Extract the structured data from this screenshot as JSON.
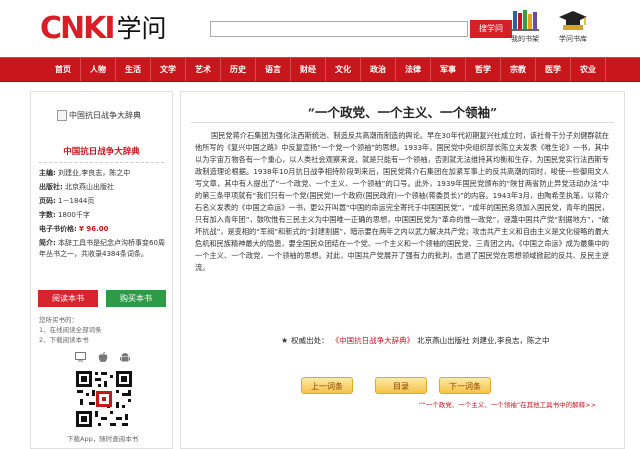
{
  "header": {
    "logo_text": "CNKI",
    "logo_cn": "学问",
    "search_value": "",
    "search_button": "搜学问",
    "shelf_mine": "我的书架",
    "shelf_library": "学问书库"
  },
  "nav": {
    "items": [
      "首页",
      "人物",
      "生活",
      "文学",
      "艺术",
      "历史",
      "语言",
      "财经",
      "文化",
      "政治",
      "法律",
      "军事",
      "哲学",
      "宗教",
      "医学",
      "农业"
    ]
  },
  "sidebar": {
    "cover_alt": "中国抗日战争大辞典",
    "book_title": "中国抗日战争大辞典",
    "editor_label": "主编:",
    "editor_value": "刘建业,李良志，陈之中",
    "publisher_label": "出版社:",
    "publisher_value": "北京燕山出版社",
    "pages_label": "页码:",
    "pages_value": "1－1844页",
    "words_label": "字数:",
    "words_value": "1800千字",
    "price_label": "电子书价格:",
    "price_value": "¥ 96.00",
    "intro_label": "简介:",
    "intro_value": "本辞工具书是纪念卢沟桥事变60周年丛书之一，共收录4384条词条。",
    "read_button": "阅读本书",
    "buy_button": "购买本书",
    "history_line1": "您所买书的：",
    "history_line2": "1、在线阅读全部词条",
    "history_line3": "2、下载阅读本书",
    "download_caption": "下载App，随时查阅本书"
  },
  "main": {
    "entry_title": "“一个政党、一个主义、一个领袖”",
    "body": "国民党蒋介石集团为强化法西斯统治、制造反共高潮而制造的舆论。早在30年代初期复兴社成立时，该社骨干分子刘健群就在他所写的《复兴中国之路》中反复宣扬“一个党一个领袖”的思想。1933年，国民党中央组织部长陈立夫发表《唯生论》一书，其中以为宇宙万物各有一个重心，以人类社会观察来说，就是只能有一个领袖，否则就无法维持其均衡和生存，为国民党实行法西斯专政制造理论根据。1938年10月抗日战争相持阶段到来后，国民党蒋介石集团在加紧军事上的反共高潮的同时，唆使一些御用文人写文章，其中有人提出了“一个政党、一个主义、一个领袖”的口号。此外，1939年国民党颁布的“陕甘两省防止异党活动办法”中的第三条甲项就有“我们只有一个党(国民党)一个政府(国民政府)一个领袖(蒋委员长)”的内容。1943年3月，由陶希圣执笔，以蒋介石名义发表的《中国之命运》一书，更公开叫嚣“中国的命运完全寄托于中国国民党”，“成年的国民务须加入国民党，青年的国民，只有加入青年团”，鼓吹惟有三民主义为中国唯一正确的思想，中国国民党为“革命的惟一政党”，诬蔑中国共产党“割据地方”，“破坏抗战”，是变相的“军阀”和新式的“封建割据”，暗示要在两年之内以武力解决共产党；攻击共产主义和自由主义是文化侵略的最大危机和民族精神最大的隐患，要全国民众团结在一个党、一个主义和一个领袖的国民党、三青团之内。《中国之命运》成为最集中的一个主义、一个政党、一个领袖的思想。对此，中国共产党展开了强有力的批判，击退了国民党在思想领域掀起的反共、反民主逆流。",
    "source_label": "权威出处：",
    "source_book": "《中国抗日战争大辞典》",
    "source_rest": "北京燕山出版社 刘建业,李良志，陈之中",
    "prev_button": "上一词条",
    "toc_button": "目录",
    "next_button": "下一词条",
    "related_prefix": "“",
    "related_text": "“一个政党、一个主义、一个领袖”",
    "related_suffix": "在其他工具书中的解释>>"
  }
}
